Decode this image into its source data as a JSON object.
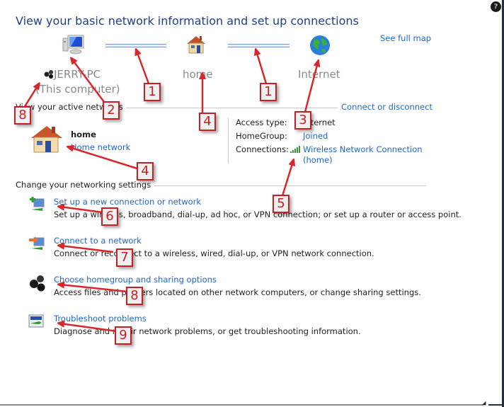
{
  "window": {
    "help_icon": "?"
  },
  "page_title": "View your basic network information and set up connections",
  "see_full_map": "See full map",
  "network_map": {
    "computer": {
      "name": "JERRY-PC",
      "subtitle": "(This computer)",
      "icon": "computer-icon"
    },
    "network": {
      "name": "home",
      "icon": "house-icon"
    },
    "internet": {
      "name": "Internet",
      "icon": "globe-icon"
    }
  },
  "active_networks": {
    "heading": "View your active networks",
    "connect_or_disconnect": "Connect or disconnect",
    "network_name": "home",
    "network_type": "Home network",
    "access_type_label": "Access type:",
    "access_type_value": "Internet",
    "homegroup_label": "HomeGroup:",
    "homegroup_value": "Joined",
    "connections_label": "Connections:",
    "connections_value_line1": "Wireless Network Connection",
    "connections_value_line2": "(home)"
  },
  "settings": {
    "heading": "Change your networking settings",
    "tasks": [
      {
        "icon": "new-connection-icon",
        "link": "Set up a new connection or network",
        "description": "Set up a wireless, broadband, dial-up, ad hoc, or VPN connection; or set up a router or access point."
      },
      {
        "icon": "connect-network-icon",
        "link": "Connect to a network",
        "description": "Connect or reconnect to a wireless, wired, dial-up, or VPN network connection."
      },
      {
        "icon": "homegroup-icon",
        "link": "Choose homegroup and sharing options",
        "description": "Access files and printers located on other network computers, or change sharing settings."
      },
      {
        "icon": "troubleshoot-icon",
        "link": "Troubleshoot problems",
        "description": "Diagnose and repair network problems, or get troubleshooting information."
      }
    ]
  },
  "annotations": [
    {
      "id": "1a",
      "number": "1"
    },
    {
      "id": "1b",
      "number": "1"
    },
    {
      "id": "2",
      "number": "2"
    },
    {
      "id": "3",
      "number": "3"
    },
    {
      "id": "4a",
      "number": "4"
    },
    {
      "id": "4b",
      "number": "4"
    },
    {
      "id": "5",
      "number": "5"
    },
    {
      "id": "6",
      "number": "6"
    },
    {
      "id": "7",
      "number": "7"
    },
    {
      "id": "8a",
      "number": "8"
    },
    {
      "id": "8b",
      "number": "8"
    },
    {
      "id": "9",
      "number": "9"
    }
  ],
  "colors": {
    "title": "#1e3f8a",
    "link": "#1e66c8",
    "annotation": "#c42026"
  }
}
